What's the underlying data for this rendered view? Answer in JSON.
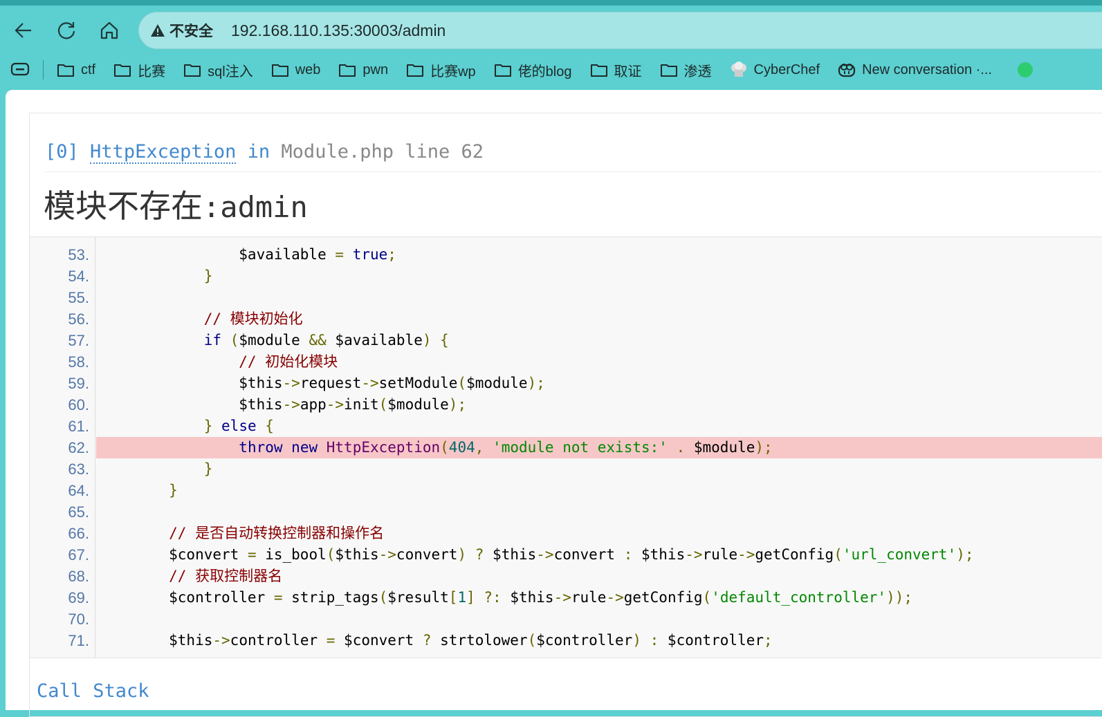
{
  "browser": {
    "security_label": "不安全",
    "url": "192.168.110.135:30003/admin",
    "bookmarks": [
      "ctf",
      "比赛",
      "sql注入",
      "web",
      "pwn",
      "比赛wp",
      "佬的blog",
      "取证",
      "渗透"
    ],
    "cyberchef": "CyberChef",
    "new_conversation": "New conversation ·..."
  },
  "error": {
    "index": "[0]",
    "exception": "HttpException",
    "in": "in",
    "location": "Module.php line 62",
    "message_cn": "模块不存在",
    "message_sep": ":",
    "message_module": "admin"
  },
  "code": {
    "highlight_line": 62,
    "lines": [
      {
        "n": "53.",
        "t": [
          [
            "pln",
            "                $available "
          ],
          [
            "pun",
            "="
          ],
          [
            "pln",
            " "
          ],
          [
            "kwd",
            "true"
          ],
          [
            "pun",
            ";"
          ]
        ]
      },
      {
        "n": "54.",
        "t": [
          [
            "pln",
            "            "
          ],
          [
            "pun",
            "}"
          ]
        ]
      },
      {
        "n": "55.",
        "t": []
      },
      {
        "n": "56.",
        "t": [
          [
            "com",
            "            // 模块初始化"
          ]
        ]
      },
      {
        "n": "57.",
        "t": [
          [
            "pln",
            "            "
          ],
          [
            "kwd",
            "if"
          ],
          [
            "pln",
            " "
          ],
          [
            "pun",
            "("
          ],
          [
            "pln",
            "$module "
          ],
          [
            "pun",
            "&&"
          ],
          [
            "pln",
            " $available"
          ],
          [
            "pun",
            ")"
          ],
          [
            "pln",
            " "
          ],
          [
            "pun",
            "{"
          ]
        ]
      },
      {
        "n": "58.",
        "t": [
          [
            "com",
            "                // 初始化模块"
          ]
        ]
      },
      {
        "n": "59.",
        "t": [
          [
            "pln",
            "                $this"
          ],
          [
            "pun",
            "->"
          ],
          [
            "pln",
            "request"
          ],
          [
            "pun",
            "->"
          ],
          [
            "pln",
            "setModule"
          ],
          [
            "pun",
            "("
          ],
          [
            "pln",
            "$module"
          ],
          [
            "pun",
            ");"
          ]
        ]
      },
      {
        "n": "60.",
        "t": [
          [
            "pln",
            "                $this"
          ],
          [
            "pun",
            "->"
          ],
          [
            "pln",
            "app"
          ],
          [
            "pun",
            "->"
          ],
          [
            "pln",
            "init"
          ],
          [
            "pun",
            "("
          ],
          [
            "pln",
            "$module"
          ],
          [
            "pun",
            ");"
          ]
        ]
      },
      {
        "n": "61.",
        "t": [
          [
            "pln",
            "            "
          ],
          [
            "pun",
            "}"
          ],
          [
            "pln",
            " "
          ],
          [
            "kwd",
            "else"
          ],
          [
            "pln",
            " "
          ],
          [
            "pun",
            "{"
          ]
        ]
      },
      {
        "n": "62.",
        "t": [
          [
            "pln",
            "                "
          ],
          [
            "kwd",
            "throw"
          ],
          [
            "pln",
            " "
          ],
          [
            "kwd",
            "new"
          ],
          [
            "pln",
            " "
          ],
          [
            "typ",
            "HttpException"
          ],
          [
            "pun",
            "("
          ],
          [
            "lit",
            "404"
          ],
          [
            "pun",
            ","
          ],
          [
            "pln",
            " "
          ],
          [
            "str",
            "'module not exists:'"
          ],
          [
            "pln",
            " "
          ],
          [
            "pun",
            "."
          ],
          [
            "pln",
            " $module"
          ],
          [
            "pun",
            ");"
          ]
        ]
      },
      {
        "n": "63.",
        "t": [
          [
            "pln",
            "            "
          ],
          [
            "pun",
            "}"
          ]
        ]
      },
      {
        "n": "64.",
        "t": [
          [
            "pln",
            "        "
          ],
          [
            "pun",
            "}"
          ]
        ]
      },
      {
        "n": "65.",
        "t": []
      },
      {
        "n": "66.",
        "t": [
          [
            "com",
            "        // 是否自动转换控制器和操作名"
          ]
        ]
      },
      {
        "n": "67.",
        "t": [
          [
            "pln",
            "        $convert "
          ],
          [
            "pun",
            "="
          ],
          [
            "pln",
            " is_bool"
          ],
          [
            "pun",
            "("
          ],
          [
            "pln",
            "$this"
          ],
          [
            "pun",
            "->"
          ],
          [
            "pln",
            "convert"
          ],
          [
            "pun",
            ")"
          ],
          [
            "pln",
            " "
          ],
          [
            "pun",
            "?"
          ],
          [
            "pln",
            " $this"
          ],
          [
            "pun",
            "->"
          ],
          [
            "pln",
            "convert "
          ],
          [
            "pun",
            ":"
          ],
          [
            "pln",
            " $this"
          ],
          [
            "pun",
            "->"
          ],
          [
            "pln",
            "rule"
          ],
          [
            "pun",
            "->"
          ],
          [
            "pln",
            "getConfig"
          ],
          [
            "pun",
            "("
          ],
          [
            "str",
            "'url_convert'"
          ],
          [
            "pun",
            ");"
          ]
        ]
      },
      {
        "n": "68.",
        "t": [
          [
            "com",
            "        // 获取控制器名"
          ]
        ]
      },
      {
        "n": "69.",
        "t": [
          [
            "pln",
            "        $controller "
          ],
          [
            "pun",
            "="
          ],
          [
            "pln",
            " strip_tags"
          ],
          [
            "pun",
            "("
          ],
          [
            "pln",
            "$result"
          ],
          [
            "pun",
            "["
          ],
          [
            "lit",
            "1"
          ],
          [
            "pun",
            "]"
          ],
          [
            "pln",
            " "
          ],
          [
            "pun",
            "?:"
          ],
          [
            "pln",
            " $this"
          ],
          [
            "pun",
            "->"
          ],
          [
            "pln",
            "rule"
          ],
          [
            "pun",
            "->"
          ],
          [
            "pln",
            "getConfig"
          ],
          [
            "pun",
            "("
          ],
          [
            "str",
            "'default_controller'"
          ],
          [
            "pun",
            "));"
          ]
        ]
      },
      {
        "n": "70.",
        "t": []
      },
      {
        "n": "71.",
        "t": [
          [
            "pln",
            "        $this"
          ],
          [
            "pun",
            "->"
          ],
          [
            "pln",
            "controller "
          ],
          [
            "pun",
            "="
          ],
          [
            "pln",
            " $convert "
          ],
          [
            "pun",
            "?"
          ],
          [
            "pln",
            " strtolower"
          ],
          [
            "pun",
            "("
          ],
          [
            "pln",
            "$controller"
          ],
          [
            "pun",
            ")"
          ],
          [
            "pln",
            " "
          ],
          [
            "pun",
            ":"
          ],
          [
            "pln",
            " $controller"
          ],
          [
            "pun",
            ";"
          ]
        ]
      }
    ]
  },
  "call_stack_title": "Call Stack"
}
